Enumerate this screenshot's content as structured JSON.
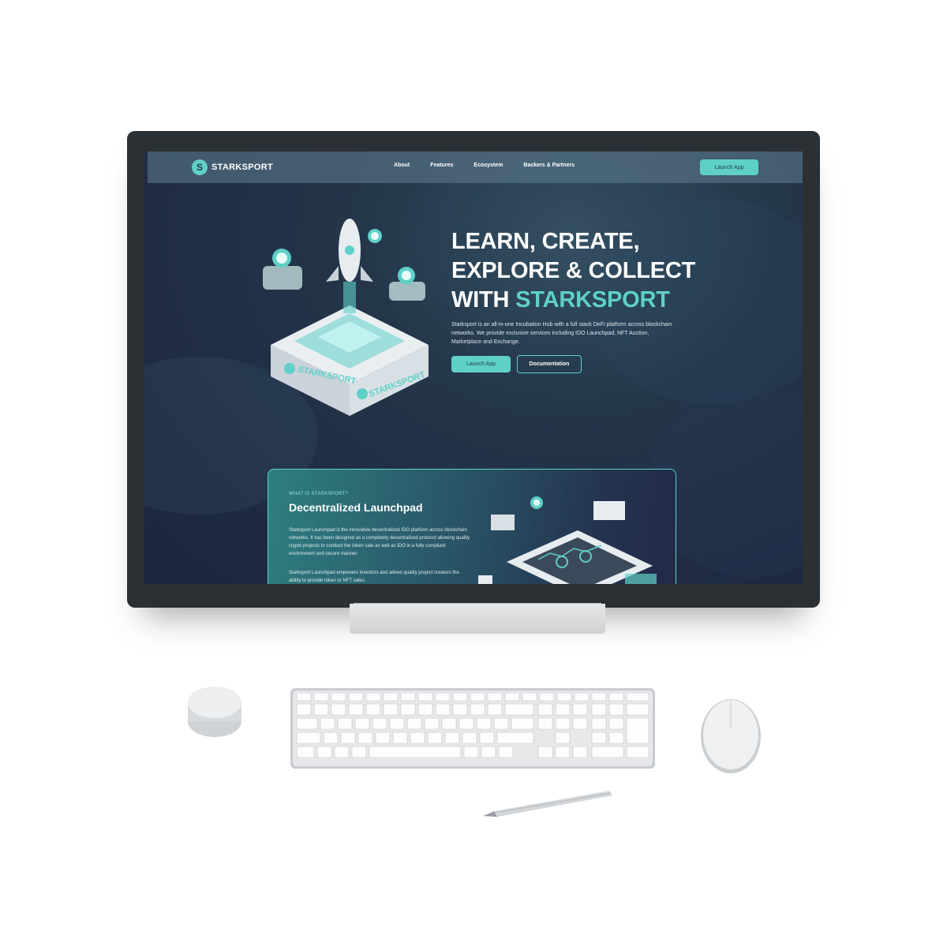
{
  "nav": {
    "brand": "STARKSPORT",
    "links": [
      "About",
      "Features",
      "Ecosystem",
      "Backers & Partners"
    ],
    "cta": "Launch App"
  },
  "hero": {
    "title_line1": "LEARN, CREATE,",
    "title_line2": "EXPLORE & COLLECT",
    "title_line3_prefix": "WITH ",
    "title_line3_accent": "STARKSPORT",
    "description": "Starksport is an all-in-one Incubation Hub with a full stack DeFi platform across blockchain networks. We provide exclusive services including IDO Launchpad, NFT Auction, Marketplace and Exchange.",
    "primary_button": "Launch App",
    "secondary_button": "Documentation",
    "illustration_brand": "STARKSPORT"
  },
  "section": {
    "eyebrow": "WHAT IS STARKSPORT?",
    "title": "Decentralized Launchpad",
    "paragraph1": "Starksport Launchpad is the innovative decentralized IDO platform across blockchain networks. It has been designed as a completely decentralized protocol allowing quality crypto projects to conduct the token sale as well as IDO in a fully compliant environment and secure manner.",
    "paragraph2": "Starksport Launchpad empowers investors and allows quality project creators the ability to provide token or NFT sales."
  },
  "colors": {
    "accent": "#5fd0c8",
    "background": "#1f2c44",
    "nav": "#608092"
  }
}
